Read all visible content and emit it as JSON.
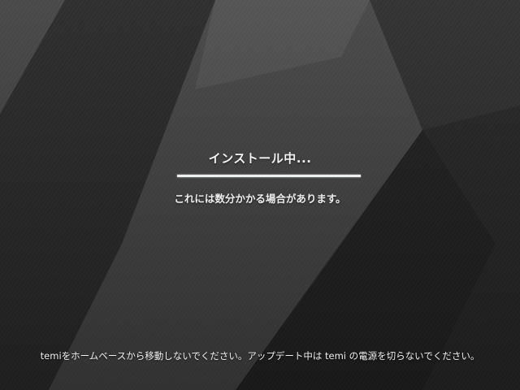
{
  "install": {
    "title": "インストール中...",
    "progress_fraction": 1.0,
    "note": "これには数分かかる場合があります。"
  },
  "footer": {
    "warning": "temiをホームベースから移動しないでください。アップデート中は temi の電源を切らないでください。"
  },
  "colors": {
    "background": "#3a3a3a",
    "text": "#f2f2f2",
    "progress": "#eef2ee"
  }
}
